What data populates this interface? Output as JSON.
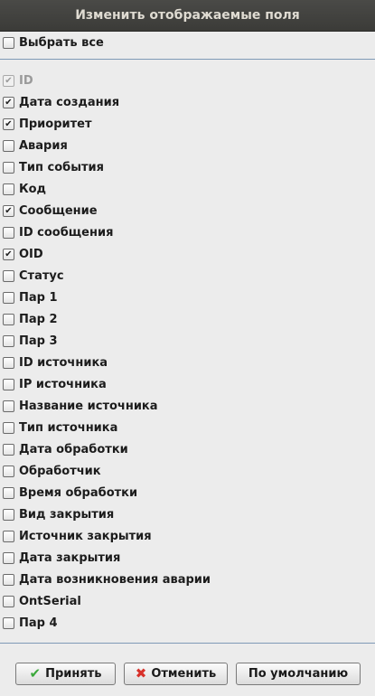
{
  "dialog": {
    "title": "Изменить отображаемые поля"
  },
  "select_all": {
    "label": "Выбрать все",
    "checked": false
  },
  "fields": [
    {
      "label": "ID",
      "checked": true,
      "disabled": true
    },
    {
      "label": "Дата создания",
      "checked": true,
      "disabled": false
    },
    {
      "label": "Приоритет",
      "checked": true,
      "disabled": false
    },
    {
      "label": "Авария",
      "checked": false,
      "disabled": false
    },
    {
      "label": "Тип события",
      "checked": false,
      "disabled": false
    },
    {
      "label": "Код",
      "checked": false,
      "disabled": false
    },
    {
      "label": "Сообщение",
      "checked": true,
      "disabled": false
    },
    {
      "label": "ID сообщения",
      "checked": false,
      "disabled": false
    },
    {
      "label": "OID",
      "checked": true,
      "disabled": false
    },
    {
      "label": "Статус",
      "checked": false,
      "disabled": false
    },
    {
      "label": "Пар 1",
      "checked": false,
      "disabled": false
    },
    {
      "label": "Пар 2",
      "checked": false,
      "disabled": false
    },
    {
      "label": "Пар 3",
      "checked": false,
      "disabled": false
    },
    {
      "label": "ID источника",
      "checked": false,
      "disabled": false
    },
    {
      "label": "IP источника",
      "checked": false,
      "disabled": false
    },
    {
      "label": "Название источника",
      "checked": false,
      "disabled": false
    },
    {
      "label": "Тип источника",
      "checked": false,
      "disabled": false
    },
    {
      "label": "Дата обработки",
      "checked": false,
      "disabled": false
    },
    {
      "label": "Обработчик",
      "checked": false,
      "disabled": false
    },
    {
      "label": "Время обработки",
      "checked": false,
      "disabled": false
    },
    {
      "label": "Вид закрытия",
      "checked": false,
      "disabled": false
    },
    {
      "label": "Источник закрытия",
      "checked": false,
      "disabled": false
    },
    {
      "label": "Дата закрытия",
      "checked": false,
      "disabled": false
    },
    {
      "label": "Дата возникновения аварии",
      "checked": false,
      "disabled": false
    },
    {
      "label": "OntSerial",
      "checked": false,
      "disabled": false
    },
    {
      "label": "Пар 4",
      "checked": false,
      "disabled": false
    }
  ],
  "buttons": {
    "accept": {
      "label": "Принять",
      "icon": "checkmark-icon"
    },
    "cancel": {
      "label": "Отменить",
      "icon": "cross-icon"
    },
    "default": {
      "label": "По умолчанию"
    }
  },
  "colors": {
    "title_bar": "#3b3b38",
    "title_text": "#dfdbd2",
    "background": "#ececec",
    "separator": "#7f9ab6",
    "accept_icon": "#3aa83a",
    "cancel_icon": "#d8312a"
  }
}
